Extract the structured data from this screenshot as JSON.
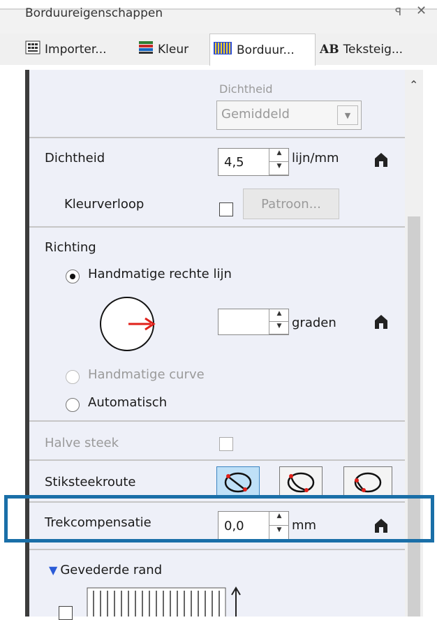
{
  "window": {
    "title": "Borduureigenschappen",
    "pin_glyph": "ꟼ",
    "close_glyph": "✕"
  },
  "tabs": [
    {
      "label": "Importer...",
      "icon": "import-icon"
    },
    {
      "label": "Kleur",
      "icon": "color-icon"
    },
    {
      "label": "Borduur...",
      "icon": "embroidery-icon"
    },
    {
      "label": "Teksteig...",
      "icon": "text-icon",
      "icon_text": "AB"
    }
  ],
  "top_section": {
    "density_caption": "Dichtheid",
    "density_value": "Gemiddeld"
  },
  "density": {
    "label": "Dichtheid",
    "value": "4,5",
    "unit": "lijn/mm",
    "gradient_label": "Kleurverloop",
    "pattern_button": "Patroon..."
  },
  "direction": {
    "label": "Richting",
    "options": [
      "Handmatige rechte lijn",
      "Handmatige curve",
      "Automatisch"
    ],
    "selected": 0,
    "angle_value": "",
    "angle_unit": "graden"
  },
  "half_stitch": {
    "label": "Halve steek"
  },
  "route": {
    "label": "Stiksteekroute",
    "selected": 0
  },
  "pull": {
    "label": "Trekcompensatie",
    "value": "0,0",
    "unit": "mm"
  },
  "feather": {
    "label": "Gevederde rand"
  },
  "colors": {
    "highlight": "#1a6fa8",
    "arrow": "#e0201a",
    "radio_active": "#bfe0f7"
  }
}
